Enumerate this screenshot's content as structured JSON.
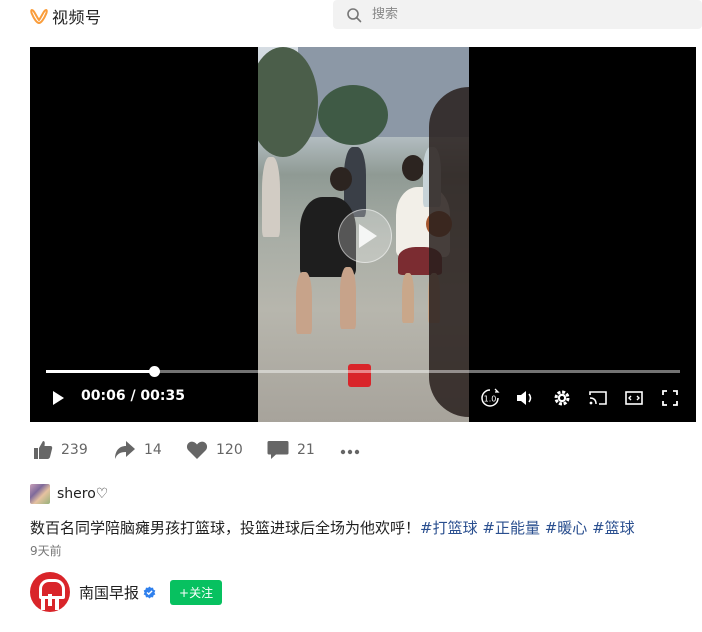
{
  "header": {
    "app_name": "视频号",
    "search_placeholder": "搜索"
  },
  "player": {
    "current_time": "00:06",
    "duration": "00:35",
    "time_display": "00:06 / 00:35",
    "progress_fraction": 0.171,
    "speed_label": "1.0"
  },
  "actions": {
    "likes": "239",
    "shares": "14",
    "favorites": "120",
    "comments": "21"
  },
  "author": {
    "name": "shero♡"
  },
  "post": {
    "text": "数百名同学陪脑瘫男孩打篮球，投篮进球后全场为他欢呼！",
    "tags": [
      "#打篮球",
      "#正能量",
      "#暖心",
      "#篮球"
    ],
    "date": "9天前"
  },
  "account": {
    "name": "南国早报",
    "follow_label": "+关注"
  },
  "colors": {
    "accent_green": "#07c160",
    "logo_orange": "#fa9d3b",
    "tag_blue": "#2a4f8f",
    "brand_red": "#d9252a"
  }
}
